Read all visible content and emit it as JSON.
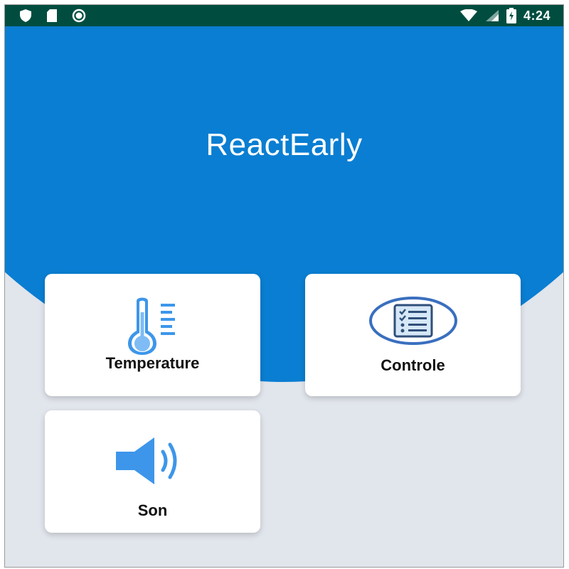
{
  "status_bar": {
    "time": "4:24",
    "icons": [
      "shield-icon",
      "sd-card-icon",
      "record-icon",
      "wifi-icon",
      "signal-icon",
      "battery-icon"
    ]
  },
  "app": {
    "title": "ReactEarly"
  },
  "cards": [
    {
      "id": "temperature",
      "label": "Temperature",
      "icon": "thermometer-icon"
    },
    {
      "id": "controle",
      "label": "Controle",
      "icon": "checklist-icon"
    },
    {
      "id": "son",
      "label": "Son",
      "icon": "speaker-icon"
    }
  ],
  "colors": {
    "status_bar": "#004d40",
    "header_blue": "#0a7ed2",
    "background": "#e1e5ec",
    "icon_blue": "#3d96ea",
    "card": "#ffffff"
  }
}
